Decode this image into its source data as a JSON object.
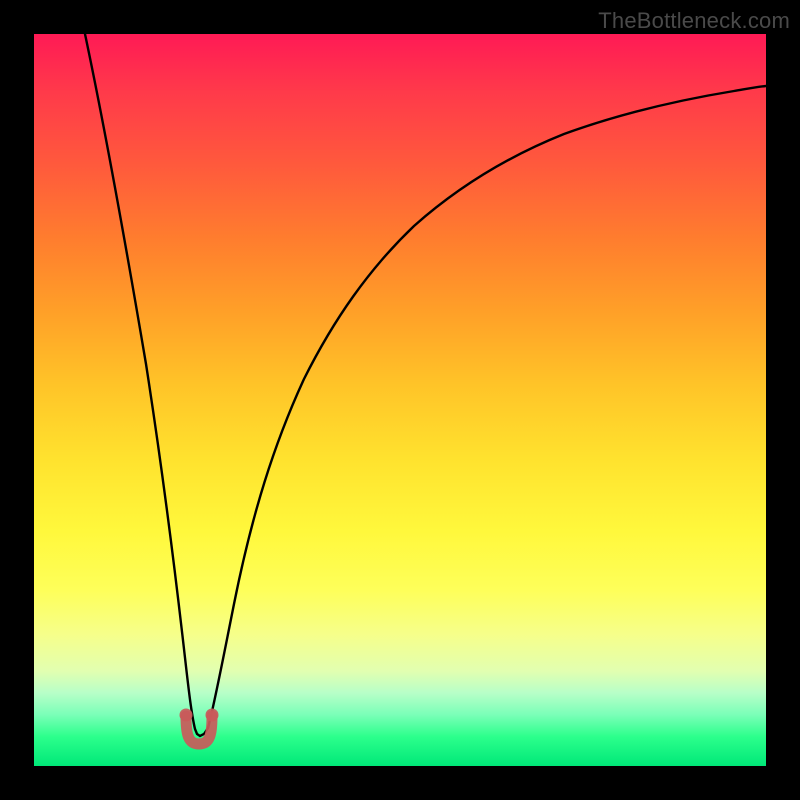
{
  "watermark": {
    "text": "TheBottleneck.com"
  },
  "colors": {
    "curve_stroke": "#000000",
    "valley_stroke": "#c95a5a",
    "valley_fill": "#c95a5a",
    "frame": "#000000"
  },
  "chart_data": {
    "type": "line",
    "title": "",
    "xlabel": "",
    "ylabel": "",
    "xlim": [
      0,
      100
    ],
    "ylim": [
      0,
      100
    ],
    "grid": false,
    "legend": false,
    "note": "Values estimated from pixel positions; y=0 at bottom (green), y=100 at top (red). Minimum (valley) near x≈22.5, y≈4.",
    "series": [
      {
        "name": "bottleneck-curve",
        "x": [
          7,
          10,
          13,
          16,
          18,
          20,
          21,
          22,
          23,
          24,
          25,
          27,
          30,
          34,
          38,
          44,
          50,
          56,
          62,
          70,
          78,
          86,
          94,
          100
        ],
        "values": [
          100,
          85,
          69,
          51,
          37,
          22,
          13,
          6,
          4,
          6,
          12,
          24,
          38,
          50,
          58,
          66,
          72,
          76,
          79,
          82,
          84.5,
          86.5,
          88,
          89
        ]
      }
    ],
    "valley_marker": {
      "x_range": [
        20.7,
        24.3
      ],
      "y": 4,
      "shape": "U",
      "color": "#c95a5a"
    }
  }
}
